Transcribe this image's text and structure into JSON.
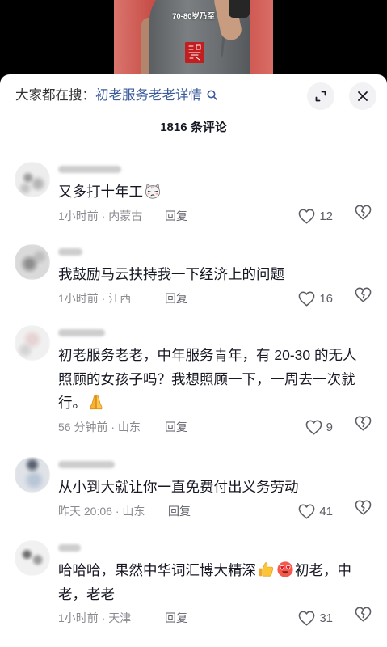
{
  "video": {
    "caption": "70-80岁乃至",
    "logo_icon": "red-seal-logo"
  },
  "header": {
    "search_prefix": "大家都在搜：",
    "search_query": "初老服务老老详情",
    "search_icon": "search-icon",
    "expand_icon": "expand-icon",
    "close_icon": "close-icon"
  },
  "comment_count_label": "1816 条评论",
  "labels": {
    "reply": "回复"
  },
  "icons": {
    "like": "heart-outline-icon",
    "dislike": "broken-heart-icon"
  },
  "comments": [
    {
      "segments": [
        {
          "text": "又多打十年工"
        },
        {
          "emoji": "grumpy-cat-emoji"
        }
      ],
      "meta": "1小时前 · 内蒙古",
      "likes": 12
    },
    {
      "segments": [
        {
          "text": "我鼓励马云扶持我一下经济上的问题"
        }
      ],
      "meta": "1小时前 · 江西",
      "likes": 16
    },
    {
      "segments": [
        {
          "text": "初老服务老老，中年服务青年，有 20-30 的无人照顾的女孩子吗？我想照顾一下，一周去一次就行。"
        },
        {
          "emoji": "folded-hands-emoji"
        }
      ],
      "meta": "56 分钟前 · 山东",
      "likes": 9
    },
    {
      "segments": [
        {
          "text": "从小到大就让你一直免费付出义务劳动"
        }
      ],
      "meta": "昨天 20:06 · 山东",
      "likes": 41
    },
    {
      "segments": [
        {
          "text": "哈哈哈，果然中华词汇博大精深"
        },
        {
          "emoji": "thumbs-up-emoji"
        },
        {
          "emoji": "heart-eyes-emoji"
        },
        {
          "text": "初老，中老，老老"
        }
      ],
      "meta": "1小时前 · 天津",
      "likes": 31
    }
  ],
  "colors": {
    "text": "#161823",
    "search_link": "#3a5a9c",
    "meta": "#8a8b91",
    "icon": "#5c5e66",
    "sheet": "#ffffff",
    "video_backdrop": "#c9514a"
  }
}
